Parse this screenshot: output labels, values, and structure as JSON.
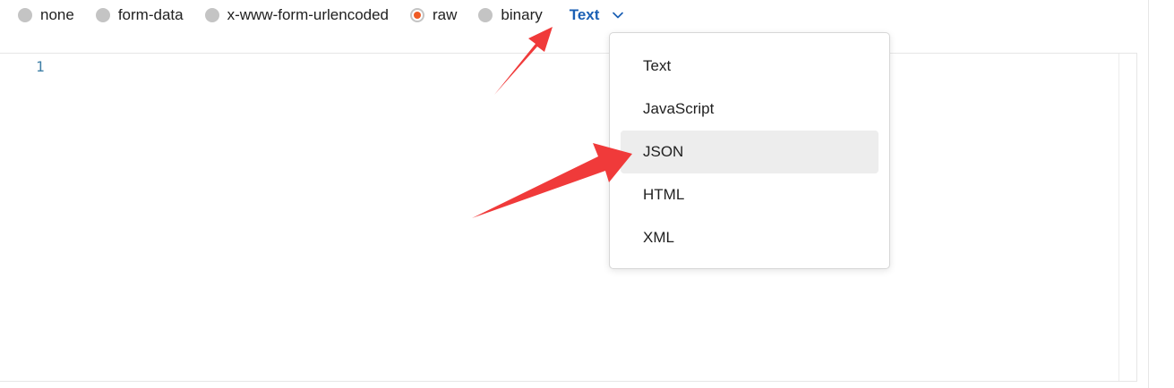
{
  "body_types": [
    {
      "label": "none",
      "selected": false
    },
    {
      "label": "form-data",
      "selected": false
    },
    {
      "label": "x-www-form-urlencoded",
      "selected": false
    },
    {
      "label": "raw",
      "selected": true
    },
    {
      "label": "binary",
      "selected": false
    }
  ],
  "format_select": {
    "value": "Text",
    "icon": "chevron-down-icon"
  },
  "editor": {
    "line_numbers": [
      "1"
    ]
  },
  "format_menu": {
    "items": [
      "Text",
      "JavaScript",
      "JSON",
      "HTML",
      "XML"
    ],
    "highlighted": "JSON"
  },
  "colors": {
    "accent_link": "#1a5fb4",
    "radio_selected": "#ef5b25",
    "annotation_arrow": "#f03a3a"
  }
}
